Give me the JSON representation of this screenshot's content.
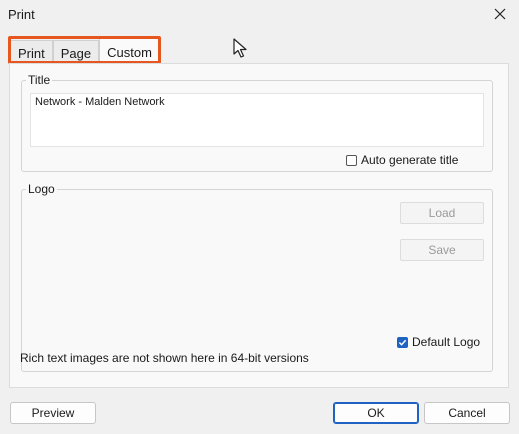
{
  "window": {
    "title": "Print"
  },
  "tabs": [
    {
      "label": "Print"
    },
    {
      "label": "Page"
    },
    {
      "label": "Custom"
    }
  ],
  "title_group": {
    "label": "Title",
    "value": "Network - Malden Network",
    "auto_generate_label": "Auto generate title",
    "auto_generate_checked": false
  },
  "logo_group": {
    "label": "Logo",
    "load_label": "Load",
    "save_label": "Save",
    "default_logo_label": "Default Logo",
    "default_logo_checked": true
  },
  "note": "Rich text images are not shown here in 64-bit versions",
  "footer": {
    "preview_label": "Preview",
    "ok_label": "OK",
    "cancel_label": "Cancel"
  },
  "colors": {
    "highlight": "#e8561f",
    "accent": "#1f62c2"
  }
}
